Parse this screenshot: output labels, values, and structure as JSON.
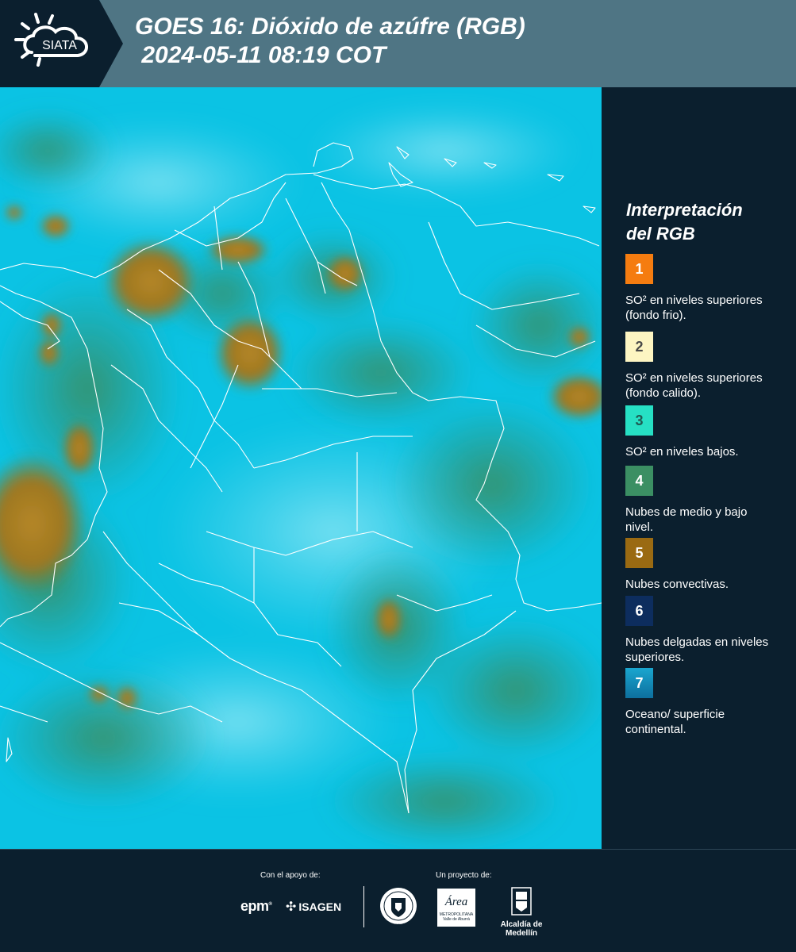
{
  "header": {
    "logo_text": "SIATA",
    "title_line1": "GOES 16: Dióxido de azúfre (RGB)",
    "title_line2": " 2024-05-11 08:19 COT"
  },
  "map": {
    "ocean_color": "#0bc5e6",
    "convective_color": "#a17a22",
    "low_cloud_color": "#3b8f63",
    "border_color": "#ffffff"
  },
  "legend": {
    "title_line1": "Interpretación",
    "title_line2": "del RGB",
    "items": [
      {
        "number": "1",
        "label": "SO² en niveles superiores (fondo frio).",
        "color": "#f57c10"
      },
      {
        "number": "2",
        "label": "SO² en niveles superiores (fondo calido).",
        "color": "#fdf5c2"
      },
      {
        "number": "3",
        "label": "SO² en niveles bajos.",
        "color": "#26e0c4"
      },
      {
        "number": "4",
        "label": "Nubes de medio y bajo nivel.",
        "color": "#3b8f63"
      },
      {
        "number": "5",
        "label": "Nubes convectivas.",
        "color": "#9a6a12"
      },
      {
        "number": "6",
        "label": "Nubes delgadas en niveles superiores.",
        "color": "#0d2d5e"
      },
      {
        "number": "7",
        "label": "Oceano/ superficie continental.",
        "color": "#1a92bf"
      }
    ]
  },
  "footer": {
    "support_label": "Con el apoyo de:",
    "project_label": "Un proyecto de:",
    "epm": "epm",
    "isagen": "ISAGEN",
    "area_name": "Área",
    "area_sub1": "METROPOLITANA",
    "area_sub2": "Valle de Aburrá",
    "alcaldia": "Alcaldía de Medellín",
    "seal_text": "MEDELLÍN"
  }
}
